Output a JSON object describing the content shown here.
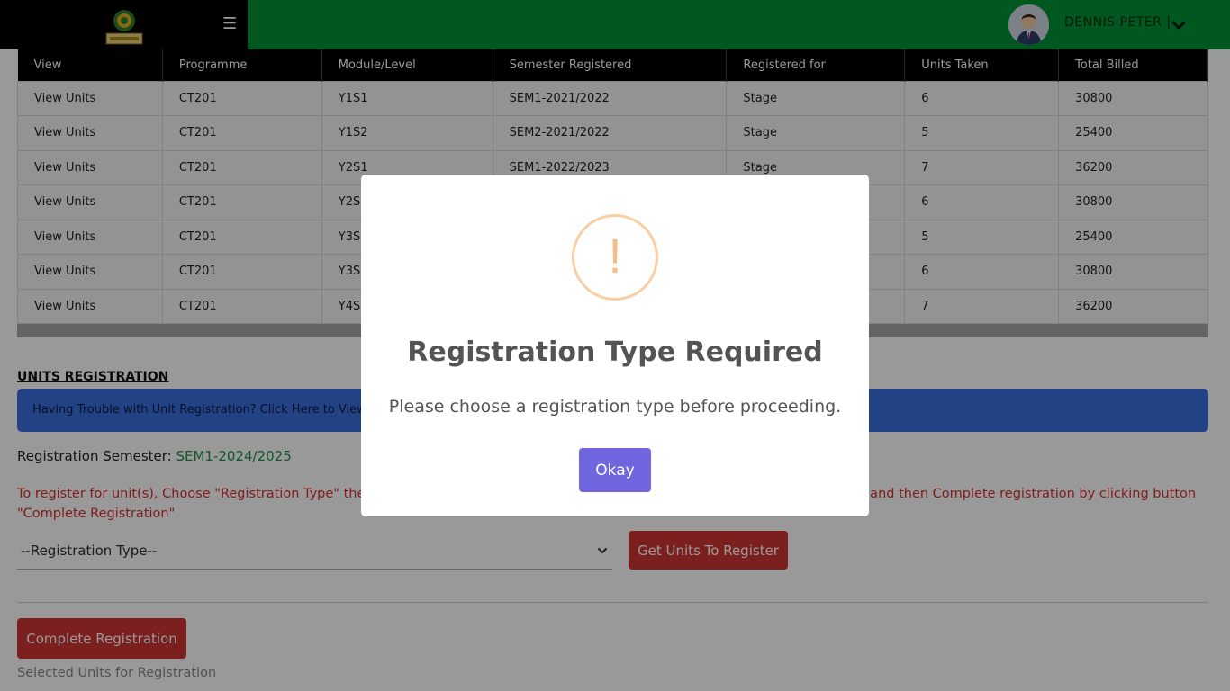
{
  "header": {
    "menu_icon": "☰",
    "user_name": "DENNIS PETER |",
    "brand_color": "#009136"
  },
  "table": {
    "columns": [
      "View",
      "Programme",
      "Module/Level",
      "Semester Registered",
      "Registered for",
      "Units Taken",
      "Total Billed"
    ],
    "rows": [
      [
        "View Units",
        "CT201",
        "Y1S1",
        "SEM1-2021/2022",
        "Stage",
        "6",
        "30800"
      ],
      [
        "View Units",
        "CT201",
        "Y1S2",
        "SEM2-2021/2022",
        "Stage",
        "5",
        "25400"
      ],
      [
        "View Units",
        "CT201",
        "Y2S1",
        "SEM1-2022/2023",
        "Stage",
        "7",
        "36200"
      ],
      [
        "View Units",
        "CT201",
        "Y2S2",
        "",
        "",
        "6",
        "30800"
      ],
      [
        "View Units",
        "CT201",
        "Y3S1",
        "",
        "",
        "5",
        "25400"
      ],
      [
        "View Units",
        "CT201",
        "Y3S2",
        "",
        "",
        "6",
        "30800"
      ],
      [
        "View Units",
        "CT201",
        "Y4S1",
        "",
        "",
        "7",
        "36200"
      ]
    ]
  },
  "units_registration": {
    "title": "UNITS REGISTRATION",
    "help_banner": "Having Trouble with Unit Registration? Click Here to View How to",
    "semester_label": "Registration Semester:",
    "semester_value": "SEM1-2024/2025",
    "instructions": "To register for unit(s), Choose \"Registration Type\" then Click \"Get Units To Register\" button, select units by ticking the checkboxes and then Complete registration by clicking button \"Complete Registration\"",
    "registration_type_placeholder": "--Registration Type--",
    "get_units_button": "Get Units To Register",
    "complete_button": "Complete Registration",
    "selected_units_label": "Selected Units for Registration"
  },
  "modal": {
    "icon": "!",
    "title": "Registration Type Required",
    "message": "Please choose a registration type before proceeding.",
    "okay_button": "Okay",
    "button_color": "#7066e0",
    "icon_color": "#f8bb86"
  }
}
